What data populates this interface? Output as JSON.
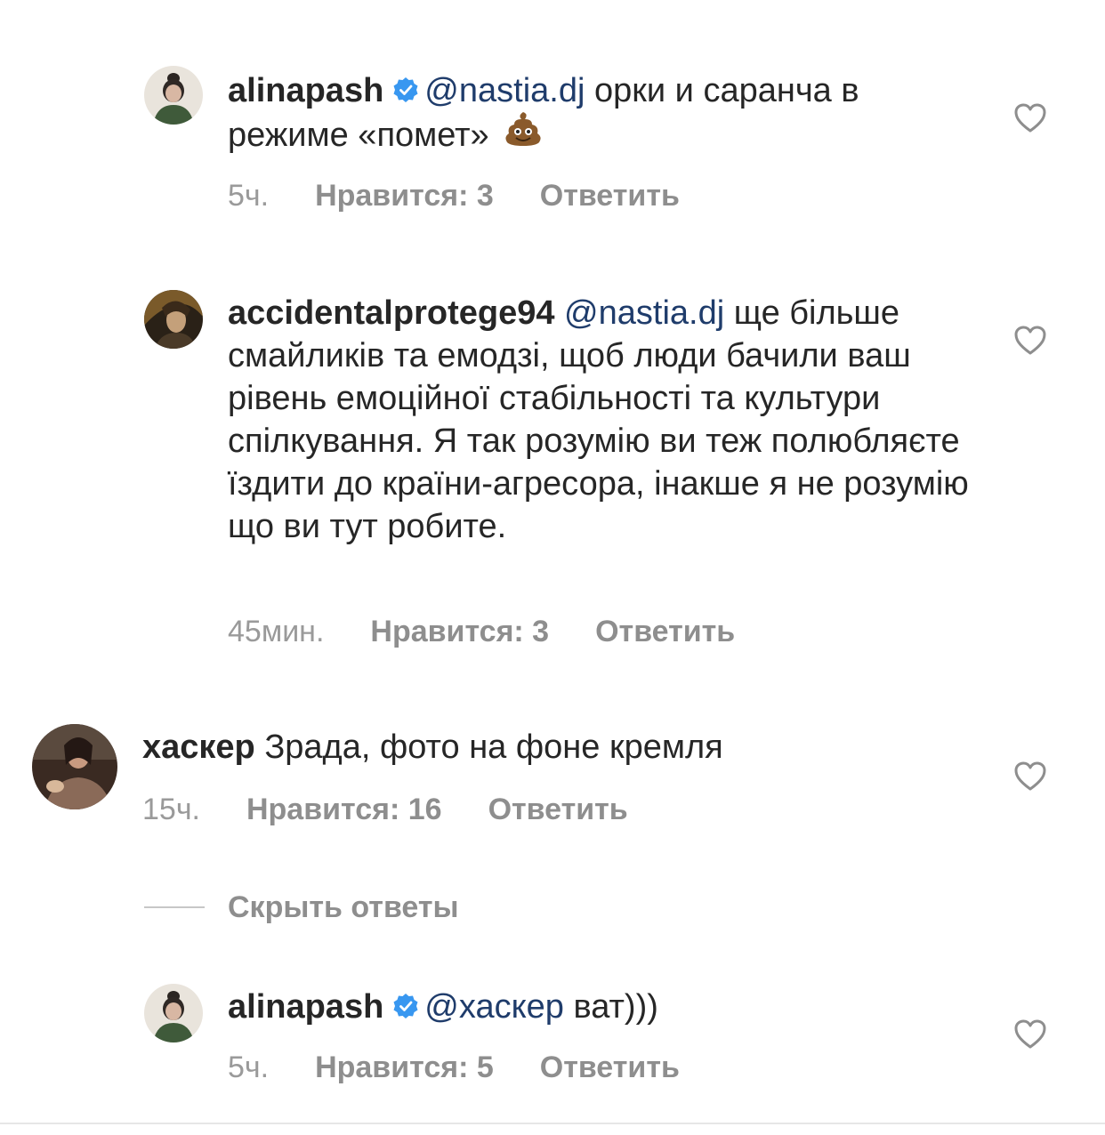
{
  "comments": [
    {
      "username": "alinapash",
      "verified": true,
      "mention": "@nastia.dj",
      "text": " орки и саранча в режиме «помет»",
      "emoji": "pile-of-poo",
      "time": "5ч.",
      "likes": "Нравится: 3",
      "reply": "Ответить"
    },
    {
      "username": "accidentalprotege94",
      "verified": false,
      "mention": "@nastia.dj",
      "text": " ще більше смайликів та емодзі, щоб люди бачили ваш рівень емоційної стабільності та культури спілкування. Я так розумію ви теж полюбляєте їздити до країни-агресора, інакше я не розумію що ви тут робите.",
      "time": "45мин.",
      "likes": "Нравится: 3",
      "reply": "Ответить"
    },
    {
      "username": "хаскер",
      "verified": false,
      "text": " Зрада, фото на фоне кремля",
      "time": "15ч.",
      "likes": "Нравится: 16",
      "reply": "Ответить"
    },
    {
      "username": "alinapash",
      "verified": true,
      "mention": "@хаскер",
      "text": " ват)))",
      "time": "5ч.",
      "likes": "Нравится: 5",
      "reply": "Ответить"
    }
  ],
  "hide_replies_label": "Скрыть ответы",
  "colors": {
    "text": "#262626",
    "mention": "#1f3c6b",
    "meta": "#8e8e8e",
    "verified": "#3897f0"
  }
}
